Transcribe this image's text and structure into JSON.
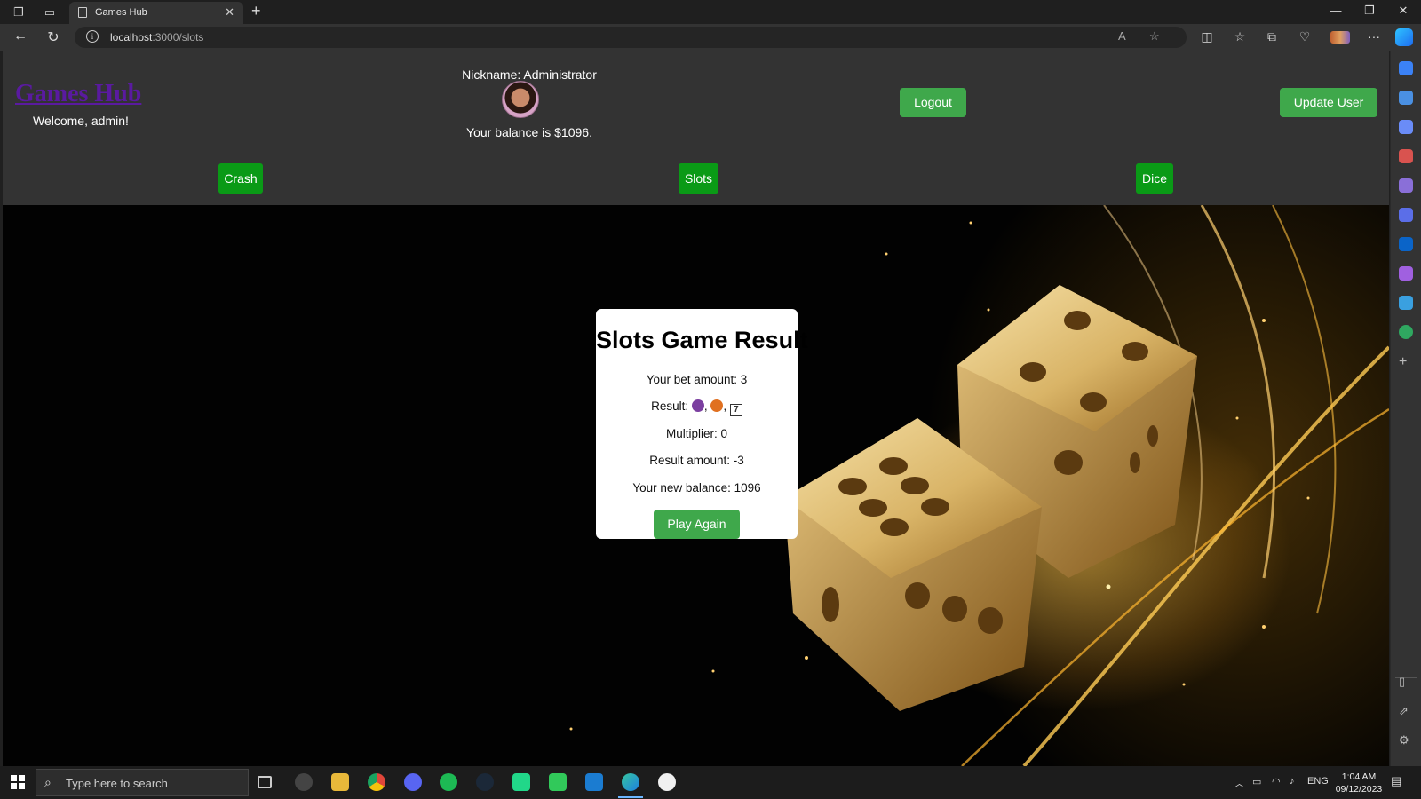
{
  "browser": {
    "tab_title": "Games Hub",
    "url_host": "localhost",
    "url_rest": ":3000/slots"
  },
  "header": {
    "brand": "Games Hub",
    "welcome": "Welcome, admin!",
    "nickname": "Nickname: Administrator",
    "balance": "Your balance is $1096.",
    "logout_label": "Logout",
    "update_user_label": "Update User"
  },
  "games_nav": [
    {
      "label": "Crash"
    },
    {
      "label": "Slots"
    },
    {
      "label": "Dice"
    }
  ],
  "result": {
    "title": "Slots Game Result",
    "bet": "Your bet amount: 3",
    "result_label": "Result:",
    "symbols": [
      "plum",
      "orange",
      "seven"
    ],
    "seven_glyph": "7",
    "multiplier": "Multiplier: 0",
    "result_amount": "Result amount: -3",
    "new_balance": "Your new balance: 1096",
    "play_again_label": "Play Again"
  },
  "taskbar": {
    "search_placeholder": "Type here to search",
    "language": "ENG",
    "time": "1:04 AM",
    "date": "09/12/2023"
  },
  "colors": {
    "accent_green": "#3fa84b",
    "nav_green": "#0a9a16",
    "brand_purple": "#5a1aa0"
  }
}
